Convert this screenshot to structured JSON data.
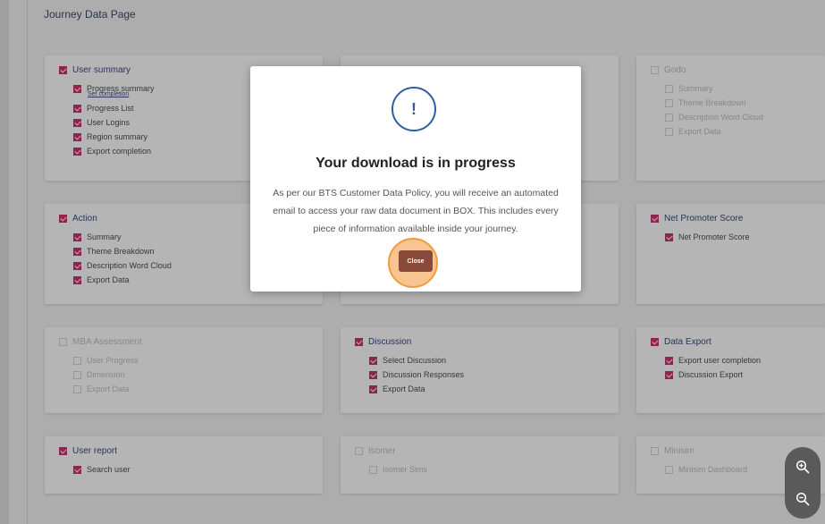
{
  "page": {
    "title": "Journey Data Page"
  },
  "cards": [
    {
      "id": "user-summary",
      "label": "User summary",
      "checked": true,
      "disabled": false,
      "items": [
        {
          "label": "Progress summary",
          "checked": true,
          "link": "Set completion"
        },
        {
          "label": "Progress List",
          "checked": true
        },
        {
          "label": "User Logins",
          "checked": true
        },
        {
          "label": "Region summary",
          "checked": true
        },
        {
          "label": "Export completion",
          "checked": true
        }
      ]
    },
    {
      "id": "godo",
      "label": "Godo",
      "checked": false,
      "disabled": true,
      "items": [
        {
          "label": "Summary",
          "checked": false
        },
        {
          "label": "Theme Breakdown",
          "checked": false
        },
        {
          "label": "Description Word Cloud",
          "checked": false
        },
        {
          "label": "Export Data",
          "checked": false
        }
      ]
    },
    {
      "id": "action",
      "label": "Action",
      "checked": true,
      "disabled": false,
      "items": [
        {
          "label": "Summary",
          "checked": true
        },
        {
          "label": "Theme Breakdown",
          "checked": true
        },
        {
          "label": "Description Word Cloud",
          "checked": true
        },
        {
          "label": "Export Data",
          "checked": true
        }
      ]
    },
    {
      "id": "nps",
      "label": "Net Promoter Score",
      "checked": true,
      "disabled": false,
      "items": [
        {
          "label": "Net Promoter Score",
          "checked": true
        }
      ]
    },
    {
      "id": "mba",
      "label": "MBA Assessment",
      "checked": false,
      "disabled": true,
      "items": [
        {
          "label": "User Progress",
          "checked": false
        },
        {
          "label": "Dimension",
          "checked": false
        },
        {
          "label": "Export Data",
          "checked": false
        }
      ]
    },
    {
      "id": "discussion",
      "label": "Discussion",
      "checked": true,
      "disabled": false,
      "items": [
        {
          "label": "Select Discussion",
          "checked": true
        },
        {
          "label": "Discussion Responses",
          "checked": true
        },
        {
          "label": "Export Data",
          "checked": true
        }
      ]
    },
    {
      "id": "data-export",
      "label": "Data Export",
      "checked": true,
      "disabled": false,
      "items": [
        {
          "label": "Export user completion",
          "checked": true
        },
        {
          "label": "Discussion Export",
          "checked": true
        }
      ]
    },
    {
      "id": "user-report",
      "label": "User report",
      "checked": true,
      "disabled": false,
      "items": [
        {
          "label": "Search user",
          "checked": true
        }
      ]
    },
    {
      "id": "isomer",
      "label": "Isomer",
      "checked": false,
      "disabled": true,
      "items": [
        {
          "label": "Isomer Sims",
          "checked": false
        }
      ]
    },
    {
      "id": "minisim",
      "label": "Minisim",
      "checked": false,
      "disabled": true,
      "items": [
        {
          "label": "Minisim Dashboard",
          "checked": false
        }
      ]
    }
  ],
  "modal": {
    "icon": "!",
    "title": "Your download is in progress",
    "message": "As per our BTS Customer Data Policy, you will receive an automated email to access your raw data document in BOX. This includes every piece of information available inside your journey.",
    "close_label": "Close"
  },
  "colors": {
    "accent": "#c2185b",
    "navy": "#1c2f6d",
    "modal_icon": "#2d5fa0",
    "close_button": "#8a4a3a",
    "highlight": "#f19a3e"
  },
  "icons": {
    "zoom_in": "zoom-in-icon",
    "zoom_out": "zoom-out-icon"
  }
}
